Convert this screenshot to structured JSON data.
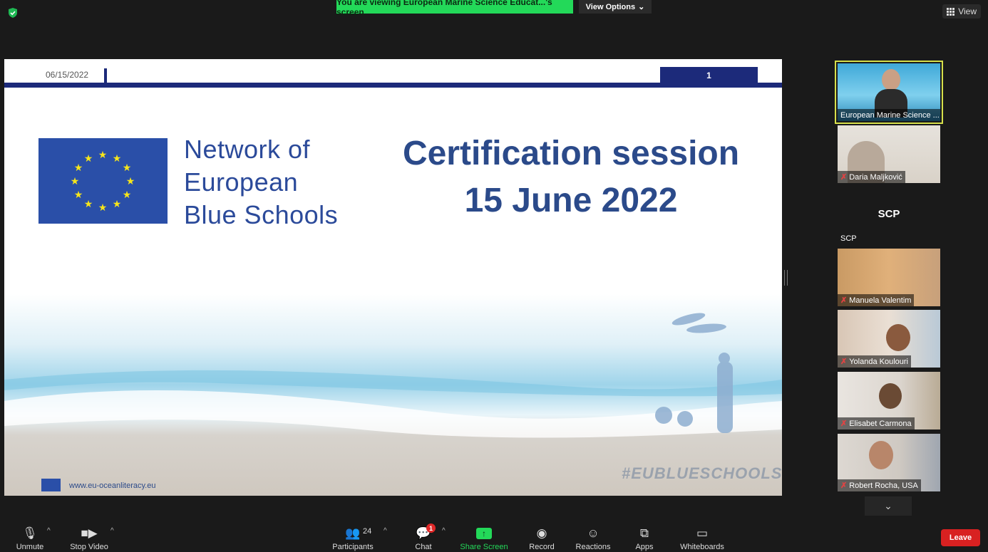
{
  "top": {
    "shield_icon": "shield-check-icon",
    "viewing_banner": "You are viewing European Marine Science Educat...'s screen",
    "view_options_label": "View Options",
    "view_label": "View"
  },
  "slide": {
    "date": "06/15/2022",
    "page_number": "1",
    "network_line1": "Network of",
    "network_line2": "European",
    "network_line3": "Blue Schools",
    "cert_line1": "Certification session",
    "cert_line2": "15 June 2022",
    "url": "www.eu-oceanliteracy.eu",
    "hashtag": "#EUBLUESCHOOLS",
    "colors": {
      "navy": "#1c2a7a",
      "eu_blue": "#2a4fa8",
      "title_blue": "#2b4a8a"
    }
  },
  "participants": [
    {
      "name": "European Marine Science ...",
      "muted": false,
      "active": true
    },
    {
      "name": "Daria Maljković",
      "muted": true
    },
    {
      "name": "SCP",
      "muted": false,
      "avatar_text": "SCP"
    },
    {
      "name": "Manuela Valentim",
      "muted": true
    },
    {
      "name": "Yolanda Koulouri",
      "muted": true
    },
    {
      "name": "Elisabet Carmona",
      "muted": true
    },
    {
      "name": "Robert Rocha, USA",
      "muted": true
    }
  ],
  "toolbar": {
    "unmute": "Unmute",
    "stop_video": "Stop Video",
    "participants": "Participants",
    "participants_count": "24",
    "chat": "Chat",
    "chat_badge": "1",
    "share_screen": "Share Screen",
    "record": "Record",
    "reactions": "Reactions",
    "apps": "Apps",
    "whiteboards": "Whiteboards",
    "leave": "Leave"
  }
}
